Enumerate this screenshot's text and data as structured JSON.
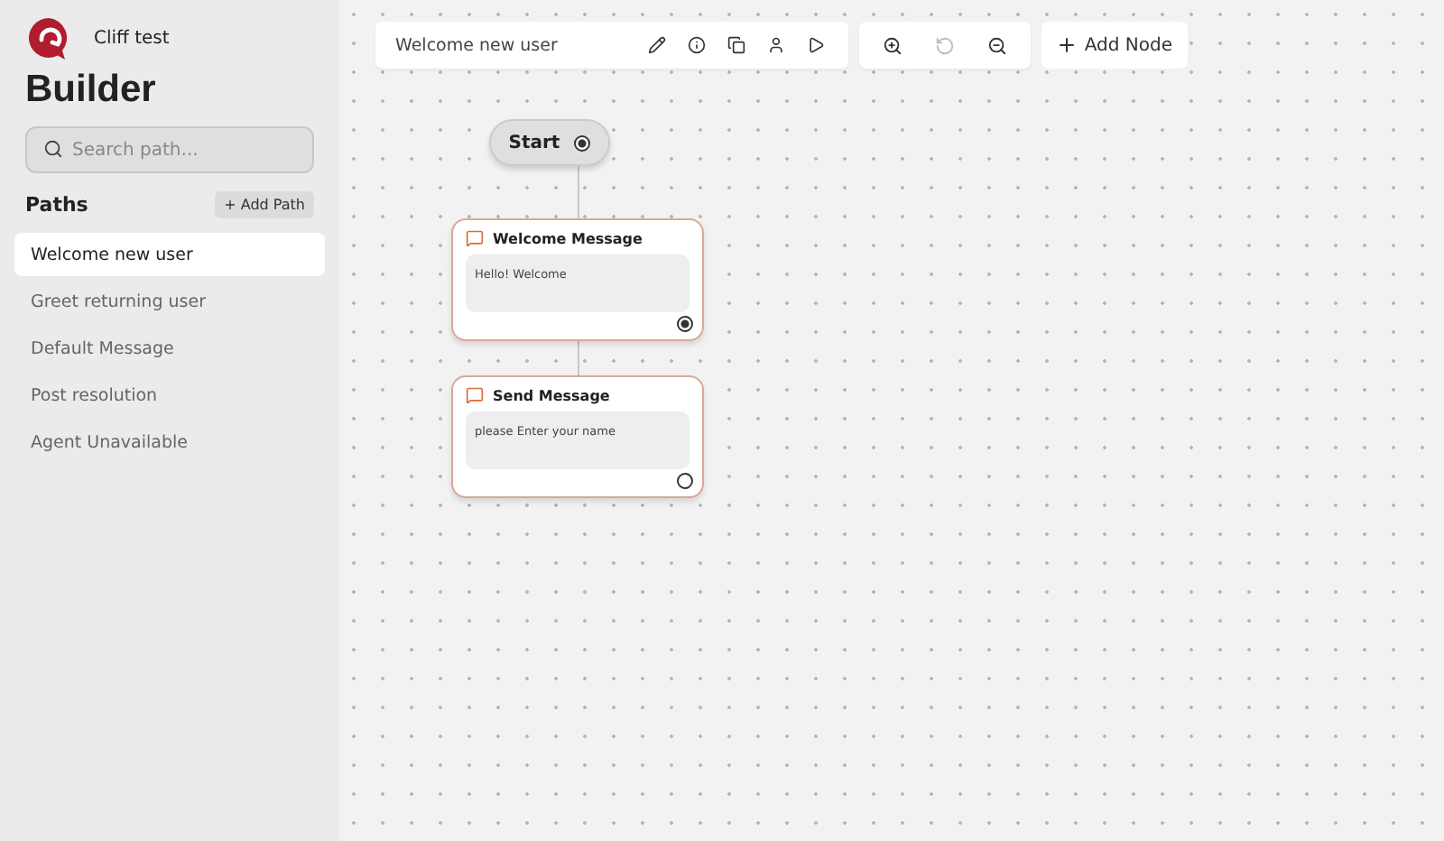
{
  "sidebar": {
    "workspace": "Cliff test",
    "title": "Builder",
    "search": {
      "placeholder": "Search path..."
    },
    "section_label": "Paths",
    "add_button": "+ Add Path",
    "items": [
      {
        "label": "Welcome new user",
        "selected": true
      },
      {
        "label": "Greet returning user",
        "selected": false
      },
      {
        "label": "Default Message",
        "selected": false
      },
      {
        "label": "Post resolution",
        "selected": false
      },
      {
        "label": "Agent Unavailable",
        "selected": false
      }
    ]
  },
  "toolbar": {
    "path_name": "Welcome new user",
    "zoom_tools": [
      {
        "kind": "zoom-in",
        "disabled": false
      },
      {
        "kind": "reset",
        "disabled": true
      },
      {
        "kind": "zoom-out",
        "disabled": false
      }
    ],
    "add_node": "Add Node"
  },
  "canvas": {
    "start": {
      "label": "Start",
      "connected": true
    },
    "nodes": [
      {
        "title": "Welcome Message",
        "text": "Hello! Welcome",
        "connected": true
      },
      {
        "title": "Send Message",
        "text": "please Enter your name",
        "connected": false
      }
    ]
  }
}
